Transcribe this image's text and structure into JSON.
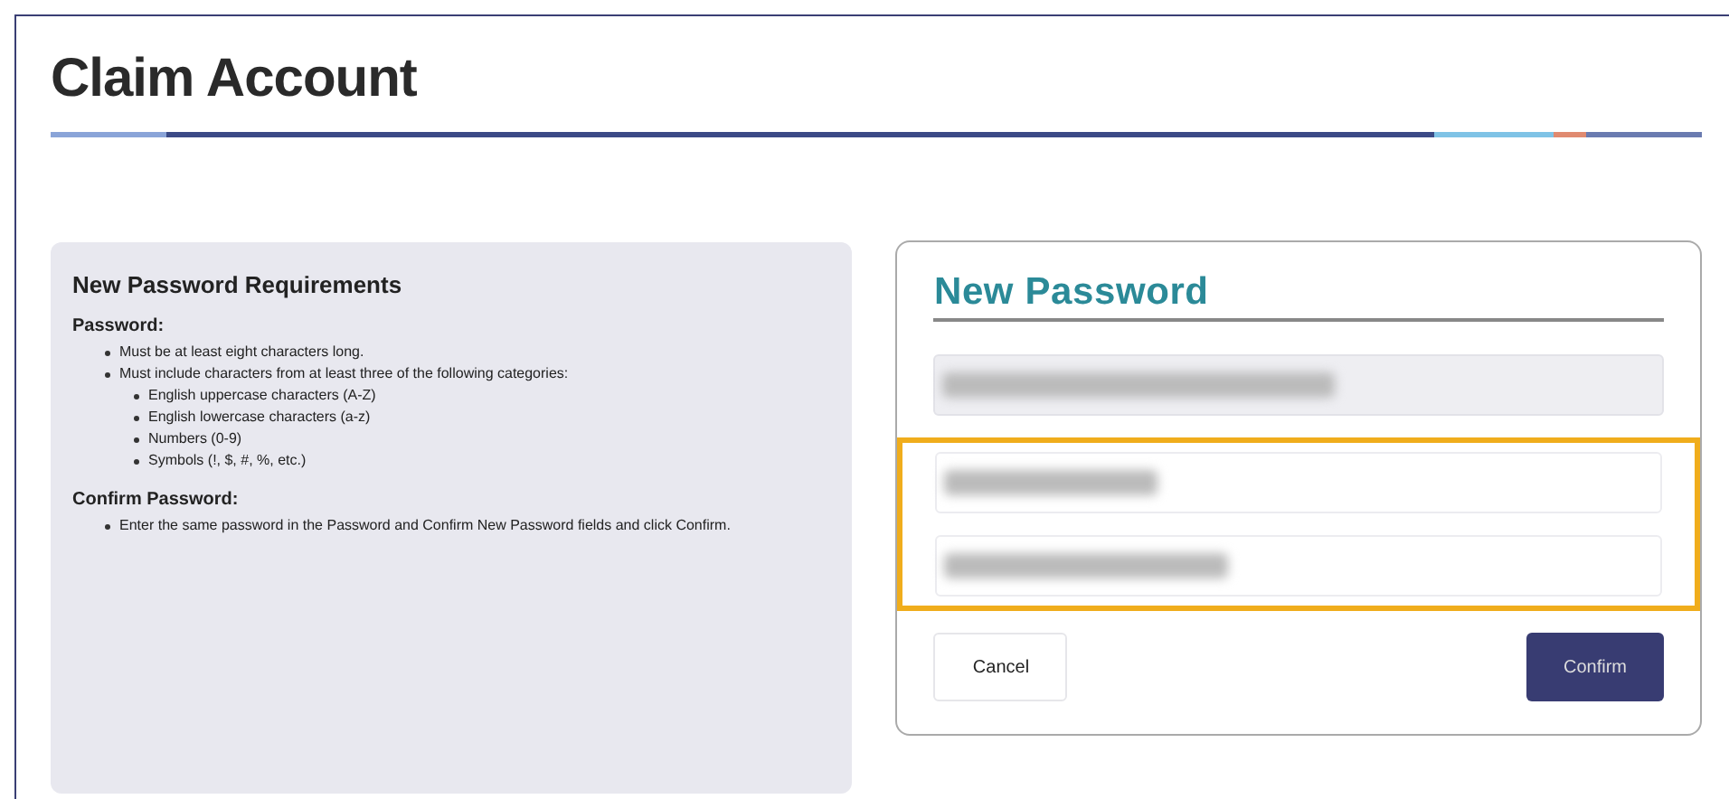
{
  "page": {
    "title": "Claim Account"
  },
  "requirements": {
    "title": "New Password Requirements",
    "sections": [
      {
        "heading": "Password:",
        "items": [
          {
            "text": "Must be at least eight characters long."
          },
          {
            "text": "Must include characters from at least three of the following categories:",
            "children": [
              {
                "text": "English uppercase characters (A-Z)"
              },
              {
                "text": "English lowercase characters (a-z)"
              },
              {
                "text": "Numbers (0-9)"
              },
              {
                "text": "Symbols (!, $, #, %, etc.)"
              }
            ]
          }
        ]
      },
      {
        "heading": "Confirm Password:",
        "items": [
          {
            "text": "Enter the same password in the Password and Confirm New Password fields and click Confirm."
          }
        ]
      }
    ]
  },
  "form": {
    "title": "New Password",
    "fields": [
      {
        "highlighted": false,
        "disabled": true,
        "level": 0.55
      },
      {
        "highlighted": true,
        "disabled": false,
        "level": 0.3
      },
      {
        "highlighted": true,
        "disabled": false,
        "level": 0.4
      }
    ],
    "buttons": [
      {
        "label": "Cancel",
        "kind": "secondary"
      },
      {
        "label": "Confirm",
        "kind": "primary"
      }
    ]
  }
}
